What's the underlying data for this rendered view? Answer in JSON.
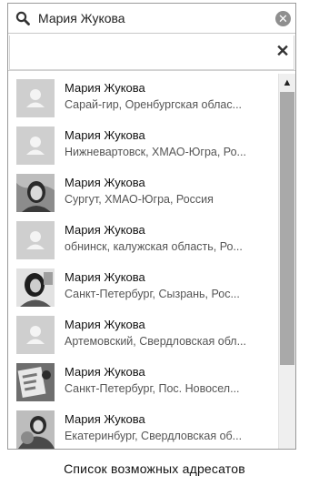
{
  "search": {
    "value": "Мария Жукова"
  },
  "results": [
    {
      "name": "Мария Жукова",
      "location": "Сарай-гир, Оренбургская облас...",
      "avatar": "placeholder"
    },
    {
      "name": "Мария Жукова",
      "location": "Нижневартовск, ХМАО-Югра, Ро...",
      "avatar": "placeholder"
    },
    {
      "name": "Мария Жукова",
      "location": "Сургут, ХМАО-Югра, Россия",
      "avatar": "photo"
    },
    {
      "name": "Мария Жукова",
      "location": "обнинск, калужская область, Ро...",
      "avatar": "placeholder"
    },
    {
      "name": "Мария Жукова",
      "location": "Санкт-Петербург, Сызрань, Рос...",
      "avatar": "photo"
    },
    {
      "name": "Мария Жукова",
      "location": "Артемовский, Свердловская обл...",
      "avatar": "placeholder"
    },
    {
      "name": "Мария Жукова",
      "location": "Санкт-Петербург, Пос. Новосел...",
      "avatar": "photo"
    },
    {
      "name": "Мария Жукова",
      "location": "Екатеринбург, Свердловская об...",
      "avatar": "photo"
    }
  ],
  "caption": "Список возможных адресатов",
  "icons": {
    "search": "search-icon",
    "clear": "clear-search-icon",
    "close": "close-icon",
    "scroll_up": "chevron-up-icon"
  },
  "colors": {
    "placeholder_avatar": "#cfcfcf",
    "scroll_thumb": "#a9a9a9"
  }
}
